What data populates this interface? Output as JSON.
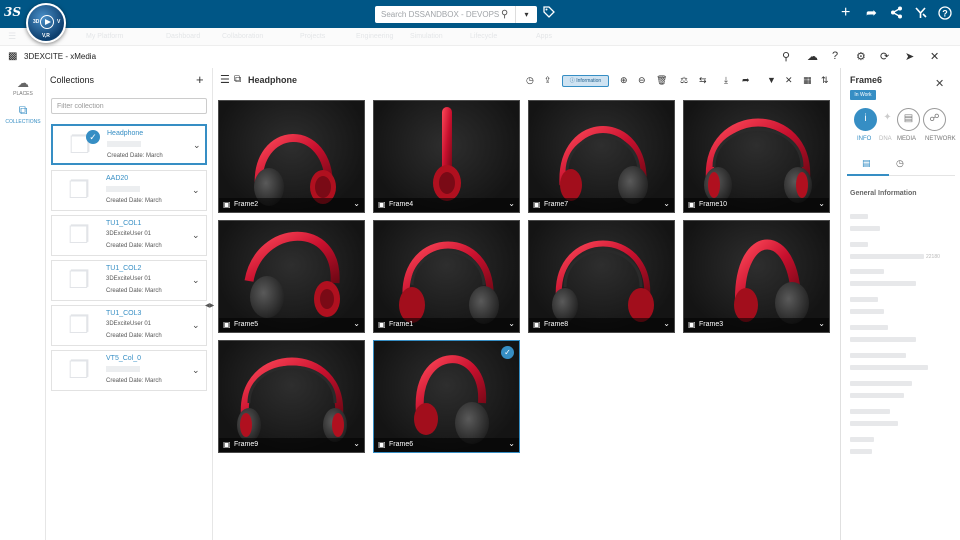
{
  "topbar": {
    "logo_text": "3S",
    "compass": {
      "north": "3D",
      "east": "V",
      "version": "V,R"
    },
    "search_placeholder": "Search DSSANDBOX - DEVOPS",
    "icons": [
      "search-icon",
      "chevron-down-icon",
      "tag-icon",
      "plus-icon",
      "share-icon",
      "network-icon",
      "community-icon",
      "help-icon"
    ]
  },
  "menubar": {
    "items": [
      "My Platform",
      "Dashboard",
      "Collaboration",
      "Projects",
      "Engineering",
      "Simulation",
      "Lifecycle",
      "Apps"
    ]
  },
  "app": {
    "title": "3DEXCITE - xMedia",
    "header_icons": [
      "search-icon",
      "cloud-icon",
      "help-icon",
      "settings-icon",
      "refresh-icon",
      "pin-icon",
      "close-icon"
    ]
  },
  "leftnav": {
    "items": [
      {
        "label": "PLACES",
        "icon": "places-icon",
        "active": false
      },
      {
        "label": "COLLECTIONS",
        "icon": "collections-icon",
        "active": true
      }
    ]
  },
  "collections": {
    "header": "Collections",
    "filter_placeholder": "Filter collection",
    "items": [
      {
        "name": "Headphone",
        "owner": "",
        "date": "Created Date: March",
        "selected": true
      },
      {
        "name": "AAD20",
        "owner": "",
        "date": "Created Date: March",
        "selected": false
      },
      {
        "name": "TU1_COL1",
        "owner": "3DExciteUser 01",
        "date": "Created Date: March",
        "selected": false
      },
      {
        "name": "TU1_COL2",
        "owner": "3DExciteUser 01",
        "date": "Created Date: March",
        "selected": false
      },
      {
        "name": "TU1_COL3",
        "owner": "3DExciteUser 01",
        "date": "Created Date: March",
        "selected": false
      },
      {
        "name": "VT5_Col_0",
        "owner": "",
        "date": "Created Date: March",
        "selected": false
      }
    ]
  },
  "main": {
    "title": "Headphone",
    "info_button": "Information",
    "toolbar_icons": [
      "history-icon",
      "upload-icon",
      "add-to-collection-icon",
      "remove-from-collection-icon",
      "delete-icon",
      "lifecycle-icon",
      "sync-icon",
      "download-icon",
      "forward-icon",
      "filter-icon",
      "clear-filter-icon",
      "grid-view-icon",
      "sort-icon"
    ],
    "tiles": [
      {
        "name": "Frame2",
        "selected": false
      },
      {
        "name": "Frame4",
        "selected": false
      },
      {
        "name": "Frame7",
        "selected": false
      },
      {
        "name": "Frame10",
        "selected": false
      },
      {
        "name": "Frame5",
        "selected": false
      },
      {
        "name": "Frame1",
        "selected": false
      },
      {
        "name": "Frame8",
        "selected": false
      },
      {
        "name": "Frame3",
        "selected": false
      },
      {
        "name": "Frame9",
        "selected": false
      },
      {
        "name": "Frame6",
        "selected": true
      }
    ]
  },
  "right_panel": {
    "title": "Frame6",
    "status_badge": "In Work",
    "tabs": [
      {
        "label": "INFO",
        "icon": "info-icon",
        "active": true
      },
      {
        "label": "DNA",
        "icon": "dna-icon",
        "active": false,
        "disabled": true
      },
      {
        "label": "MEDIA",
        "icon": "document-icon",
        "active": false
      },
      {
        "label": "NETWORK",
        "icon": "network-icon",
        "active": false
      }
    ],
    "subtabs": [
      "document-icon",
      "history-icon"
    ],
    "section_title": "General Information",
    "field_value_suffix": "22180"
  },
  "colors": {
    "topbar": "#005686",
    "accent": "#368ec4",
    "headphone_red": "#c8102e"
  }
}
